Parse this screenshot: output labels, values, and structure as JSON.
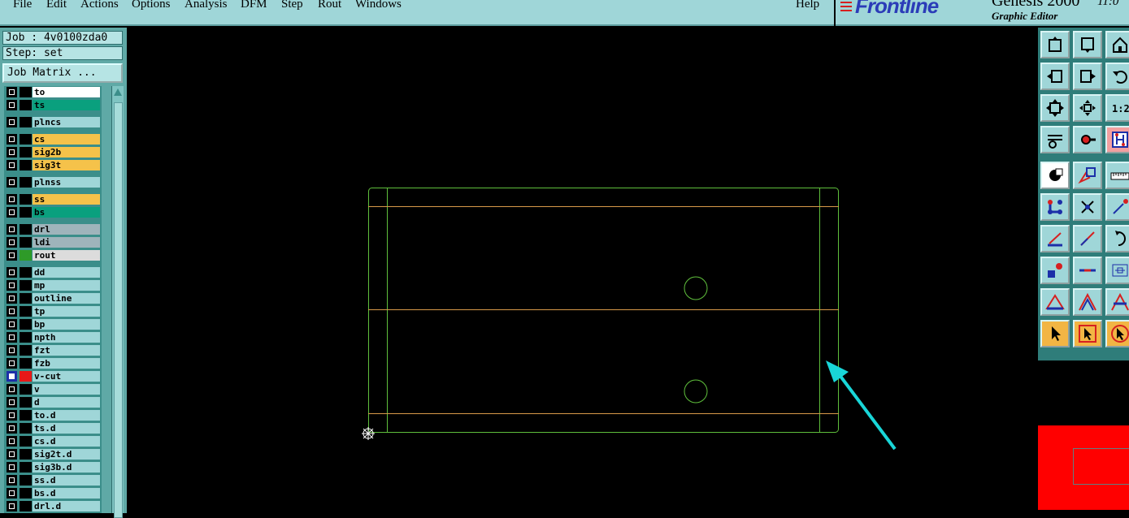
{
  "menu": {
    "items": [
      "File",
      "Edit",
      "Actions",
      "Options",
      "Analysis",
      "DFM",
      "Step",
      "Rout",
      "Windows"
    ],
    "help": "Help"
  },
  "brand": {
    "logo": "Frontline",
    "product": "Genesis 2000",
    "subtitle": "Graphic Editor",
    "time": "11:0"
  },
  "job": {
    "job_label": "Job : 4v0100zda0",
    "step_label": "Step: set",
    "matrix_button": "Job Matrix ..."
  },
  "layers": [
    {
      "name": "to",
      "color": "#ffffff",
      "swatch": "#000000"
    },
    {
      "name": "ts",
      "color": "#0aa07e",
      "swatch": "#000000"
    },
    {
      "name": "plncs",
      "color": "#9fd6d8",
      "swatch": "#000000"
    },
    {
      "name": "cs",
      "color": "#f5c24a",
      "swatch": "#000000"
    },
    {
      "name": "sig2b",
      "color": "#f5c24a",
      "swatch": "#000000"
    },
    {
      "name": "sig3t",
      "color": "#f5c24a",
      "swatch": "#000000"
    },
    {
      "name": "plnss",
      "color": "#9fd6d8",
      "swatch": "#000000"
    },
    {
      "name": "ss",
      "color": "#f5c24a",
      "swatch": "#000000"
    },
    {
      "name": "bs",
      "color": "#0aa07e",
      "swatch": "#000000"
    },
    {
      "name": "drl",
      "color": "#9fb4bb",
      "swatch": "#000000"
    },
    {
      "name": "ldi",
      "color": "#9fb4bb",
      "swatch": "#000000"
    },
    {
      "name": "rout",
      "color": "#dcdcdc",
      "swatch": "#2e9a28"
    },
    {
      "name": "dd",
      "color": "#9fd6d8",
      "swatch": "#000000"
    },
    {
      "name": "mp",
      "color": "#9fd6d8",
      "swatch": "#000000"
    },
    {
      "name": "outline",
      "color": "#9fd6d8",
      "swatch": "#000000"
    },
    {
      "name": "tp",
      "color": "#9fd6d8",
      "swatch": "#000000"
    },
    {
      "name": "bp",
      "color": "#9fd6d8",
      "swatch": "#000000"
    },
    {
      "name": "npth",
      "color": "#9fd6d8",
      "swatch": "#000000"
    },
    {
      "name": "fzt",
      "color": "#9fd6d8",
      "swatch": "#000000"
    },
    {
      "name": "fzb",
      "color": "#9fd6d8",
      "swatch": "#000000"
    },
    {
      "name": "v-cut",
      "color": "#9fd6d8",
      "swatch": "#e81818",
      "active": true
    },
    {
      "name": "v",
      "color": "#9fd6d8",
      "swatch": "#000000"
    },
    {
      "name": "d",
      "color": "#9fd6d8",
      "swatch": "#000000"
    },
    {
      "name": "to.d",
      "color": "#9fd6d8",
      "swatch": "#000000"
    },
    {
      "name": "ts.d",
      "color": "#9fd6d8",
      "swatch": "#000000"
    },
    {
      "name": "cs.d",
      "color": "#9fd6d8",
      "swatch": "#000000"
    },
    {
      "name": "sig2t.d",
      "color": "#9fd6d8",
      "swatch": "#000000"
    },
    {
      "name": "sig3b.d",
      "color": "#9fd6d8",
      "swatch": "#000000"
    },
    {
      "name": "ss.d",
      "color": "#9fd6d8",
      "swatch": "#000000"
    },
    {
      "name": "bs.d",
      "color": "#9fd6d8",
      "swatch": "#000000"
    },
    {
      "name": "drl.d",
      "color": "#9fd6d8",
      "swatch": "#000000"
    }
  ],
  "toolbar": {
    "icons": [
      "zoom-home-icon",
      "zoom-page-icon",
      "zoom-house-icon",
      "pan-left-icon",
      "pan-right-icon",
      "undo-icon",
      "zoom-fit-icon",
      "zoom-center-icon",
      "scale-1-2-icon",
      "settings-icon",
      "snap-icon",
      "grid-snap-icon",
      "feature-select-icon",
      "shape-icon",
      "ruler-icon",
      "connect-points-icon",
      "cross-icon",
      "line-point-icon",
      "angle-line-icon",
      "diagonal-line-icon",
      "arc-icon",
      "pad-add-icon",
      "minus-line-icon",
      "measure-icon",
      "triangle-a-icon",
      "triangle-b-icon",
      "triangle-c-icon",
      "pointer-icon",
      "pointer-box-icon",
      "pointer-circle-icon"
    ],
    "scale_label": "1:2"
  },
  "colors": {
    "outline_green": "#5fbf3c",
    "vcut_orange": "#d99a4a",
    "annotation_arrow": "#19d6d8",
    "minimap_red": "#ff0000"
  }
}
